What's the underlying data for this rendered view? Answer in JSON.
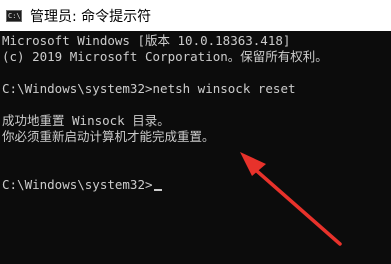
{
  "window": {
    "title": "管理员: 命令提示符",
    "icon": "cmd-icon",
    "icon_text": "C:\\"
  },
  "terminal": {
    "lines": [
      "Microsoft Windows [版本 10.0.18363.418]",
      "(c) 2019 Microsoft Corporation。保留所有权利。",
      "",
      "C:\\Windows\\system32>netsh winsock reset",
      "",
      "成功地重置 Winsock 目录。",
      "你必须重新启动计算机才能完成重置。",
      "",
      "",
      "C:\\Windows\\system32>"
    ]
  },
  "annotation": {
    "arrow_color": "#e8322b",
    "icon": "red-arrow-pointer"
  }
}
